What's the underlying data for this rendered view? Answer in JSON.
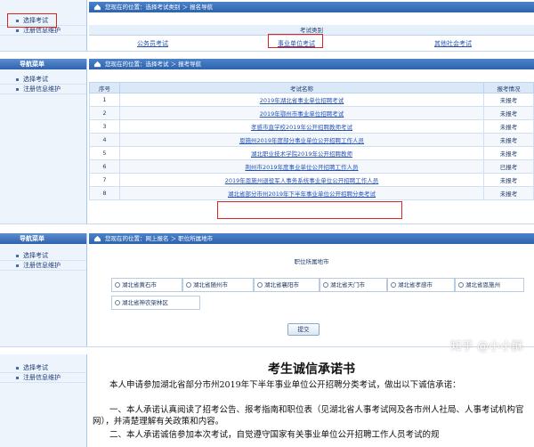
{
  "sidebar": {
    "title": "导航菜单",
    "items": [
      "选择考试",
      "注册信息维护"
    ]
  },
  "panel1": {
    "breadcrumb": "您现在的位置：选择考试类别  ＞  报名导航",
    "section_title": "考试类别",
    "categories": [
      "公务员考试",
      "事业单位考试",
      "其他社会考试"
    ]
  },
  "panel2": {
    "breadcrumb": "您现在的位置：选择考试  ＞  报考导航",
    "columns": [
      "序号",
      "考试名称",
      "报考情况"
    ],
    "rows": [
      {
        "no": "1",
        "name": "2019年湖北省事业单位招聘考试",
        "status": "未报考"
      },
      {
        "no": "2",
        "name": "2019年鄂州市事业单位招聘考试",
        "status": "未报考"
      },
      {
        "no": "3",
        "name": "孝感市直学校2019年公开招聘教师考试",
        "status": "未报考"
      },
      {
        "no": "4",
        "name": "恩施州2019年度部分事业单位公开招聘工作人员",
        "status": "未报考"
      },
      {
        "no": "5",
        "name": "湖北职业技术学院2019年公开招聘教师",
        "status": "未报考"
      },
      {
        "no": "6",
        "name": "荆州市2019年度事业单位公开招聘工作人员",
        "status": "已报考"
      },
      {
        "no": "7",
        "name": "2019年恩施州退役军人事务系统事业单位公开招聘工作人员",
        "status": "未报考"
      },
      {
        "no": "8",
        "name": "湖北省部分市州2019年下半年事业单位公开招聘分类考试",
        "status": "未报考"
      }
    ]
  },
  "panel3": {
    "breadcrumb": "您现在的位置：网上报名  ＞  职位所属地市",
    "section_title": "职位所属地市",
    "cities": [
      "湖北省黄石市",
      "湖北省随州市",
      "湖北省襄阳市",
      "湖北省天门市",
      "湖北省孝感市",
      "湖北省恩施州",
      "湖北省神农架林区"
    ],
    "submit_label": "提交"
  },
  "panel4": {
    "title": "考生诚信承诺书",
    "paragraphs": [
      "本人申请参加湖北省部分市州2019年下半年事业单位公开招聘分类考试，做出以下诚信承诺：",
      "一、本人承诺认真阅读了招考公告、报考指南和职位表（见湖北省人事考试网及各市州人社局、人事考试机构官网），并清楚理解有关政策和内容。",
      "二、本人承诺诚信参加本次考试，自觉遵守国家有关事业单位公开招聘工作人员考试的规"
    ],
    "watermark": "知乎 @小小酥"
  },
  "colors": {
    "accent_red": "#d9261c",
    "nav_blue": "#2f62ad",
    "link_blue": "#2452b4"
  }
}
